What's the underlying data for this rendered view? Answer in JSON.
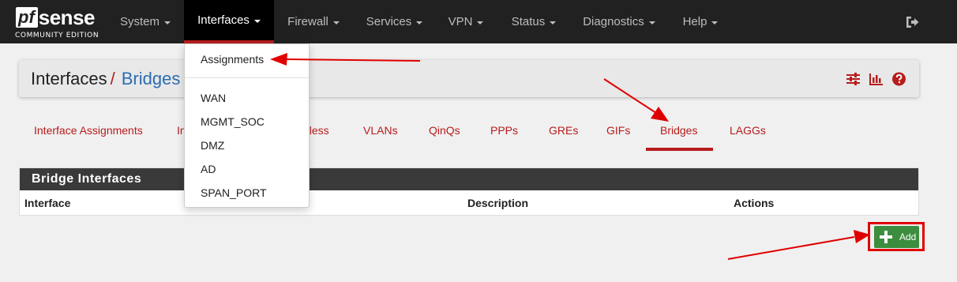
{
  "brand": {
    "logo_pf": "pf",
    "logo_sense": "sense",
    "edition": "COMMUNITY EDITION"
  },
  "nav": {
    "items": [
      {
        "label": "System"
      },
      {
        "label": "Interfaces"
      },
      {
        "label": "Firewall"
      },
      {
        "label": "Services"
      },
      {
        "label": "VPN"
      },
      {
        "label": "Status"
      },
      {
        "label": "Diagnostics"
      },
      {
        "label": "Help"
      }
    ],
    "active": "Interfaces"
  },
  "dropdown": {
    "items": [
      {
        "label": "Assignments"
      },
      {
        "label": "WAN"
      },
      {
        "label": "MGMT_SOC"
      },
      {
        "label": "DMZ"
      },
      {
        "label": "AD"
      },
      {
        "label": "SPAN_PORT"
      }
    ]
  },
  "breadcrumb": {
    "root": "Interfaces",
    "separator": "/",
    "current": "Bridges"
  },
  "tabs": [
    {
      "label": "Interface Assignments"
    },
    {
      "label": "In"
    },
    {
      "label": "eless"
    },
    {
      "label": "VLANs"
    },
    {
      "label": "QinQs"
    },
    {
      "label": "PPPs"
    },
    {
      "label": "GREs"
    },
    {
      "label": "GIFs"
    },
    {
      "label": "Bridges"
    },
    {
      "label": "LAGGs"
    }
  ],
  "active_tab": "Bridges",
  "panel": {
    "title": "Bridge Interfaces",
    "columns": [
      "Interface",
      "Description",
      "Actions"
    ]
  },
  "add_button": {
    "label": "Add"
  },
  "colors": {
    "navbar": "#212121",
    "accent_red": "#b71c1c",
    "link_blue": "#2b6cb0",
    "add_green": "#3c8d3e",
    "annotation_red": "#e00000"
  }
}
